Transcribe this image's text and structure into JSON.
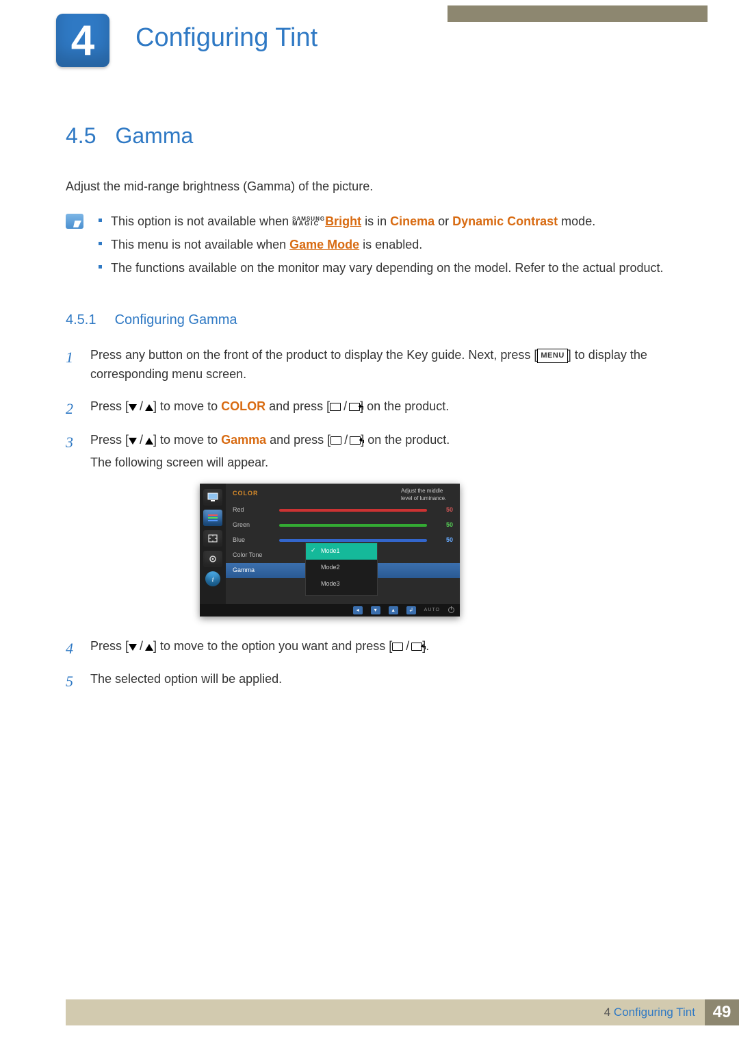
{
  "chapter": {
    "number": "4",
    "title": "Configuring Tint"
  },
  "section": {
    "number": "4.5",
    "title": "Gamma"
  },
  "intro": "Adjust the mid-range brightness (Gamma) of the picture.",
  "notes": {
    "item1_prefix": "This option is not available when ",
    "magic_top": "SAMSUNG",
    "magic_bottom": "MAGIC",
    "bright": "Bright",
    "item1_mid": " is in ",
    "cinema": "Cinema",
    "item1_or": " or ",
    "dyncon": "Dynamic Contrast",
    "item1_suffix": " mode.",
    "item2_prefix": "This menu is not available when ",
    "gamemode": "Game Mode",
    "item2_suffix": " is enabled.",
    "item3": "The functions available on the monitor may vary depending on the model. Refer to the actual product."
  },
  "subsection": {
    "number": "4.5.1",
    "title": "Configuring Gamma"
  },
  "steps": {
    "s1_a": "Press any button on the front of the product to display the Key guide. Next, press [",
    "menu": "MENU",
    "s1_b": "] to display the corresponding menu screen.",
    "s2_a": "Press [",
    "s2_b": "] to move to ",
    "color": "COLOR",
    "s2_c": " and press [",
    "s2_d": "] on the product.",
    "s3_a": "Press [",
    "s3_b": "] to move to ",
    "gamma": "Gamma",
    "s3_c": " and press [",
    "s3_d": "] on the product.",
    "s3_follow": "The following screen will appear.",
    "s4_a": "Press [",
    "s4_b": "] to move to the option you want and press [",
    "s4_c": "].",
    "s5": "The selected option will be applied."
  },
  "osd": {
    "header": "COLOR",
    "rows": {
      "red": {
        "label": "Red",
        "value": "50"
      },
      "green": {
        "label": "Green",
        "value": "50"
      },
      "blue": {
        "label": "Blue",
        "value": "50"
      },
      "tone": {
        "label": "Color Tone"
      },
      "gamma": {
        "label": "Gamma"
      }
    },
    "options": {
      "o1": "Mode1",
      "o2": "Mode2",
      "o3": "Mode3"
    },
    "help": "Adjust the middle level of luminance.",
    "auto": "AUTO"
  },
  "footer": {
    "chapnum": "4",
    "chapname": "Configuring Tint",
    "page": "49"
  }
}
